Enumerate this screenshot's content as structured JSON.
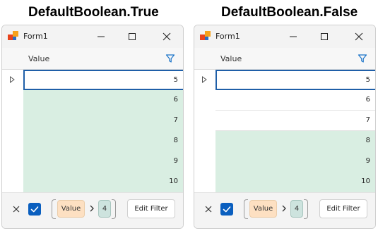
{
  "panels": [
    {
      "caption": "DefaultBoolean.True",
      "window_title": "Form1",
      "column_header": "Value",
      "rows": [
        {
          "value": "5",
          "highlighted": false,
          "focused": true
        },
        {
          "value": "6",
          "highlighted": true,
          "focused": false
        },
        {
          "value": "7",
          "highlighted": true,
          "focused": false
        },
        {
          "value": "8",
          "highlighted": true,
          "focused": false
        },
        {
          "value": "9",
          "highlighted": true,
          "focused": false
        },
        {
          "value": "10",
          "highlighted": true,
          "focused": false
        }
      ],
      "filter": {
        "field": "Value",
        "operator": ">",
        "value": "4",
        "edit_label": "Edit Filter",
        "enabled": true
      }
    },
    {
      "caption": "DefaultBoolean.False",
      "window_title": "Form1",
      "column_header": "Value",
      "rows": [
        {
          "value": "5",
          "highlighted": false,
          "focused": true
        },
        {
          "value": "6",
          "highlighted": false,
          "focused": false
        },
        {
          "value": "7",
          "highlighted": false,
          "focused": false
        },
        {
          "value": "8",
          "highlighted": true,
          "focused": false
        },
        {
          "value": "9",
          "highlighted": true,
          "focused": false
        },
        {
          "value": "10",
          "highlighted": true,
          "focused": false
        }
      ],
      "filter": {
        "field": "Value",
        "operator": ">",
        "value": "4",
        "edit_label": "Edit Filter",
        "enabled": true
      }
    }
  ],
  "colors": {
    "highlight_row": "#d9eee2",
    "focus_border": "#1f5fa8",
    "accent_blue": "#0a5fbf",
    "filter_field_chip": "#fde0c2",
    "filter_value_chip": "#cde3de",
    "filter_icon": "#1a73c8"
  },
  "icons": {
    "app": "winforms-app-icon",
    "minimize": "minimize-icon",
    "maximize": "maximize-icon",
    "close": "close-icon",
    "column_filter": "filter-funnel-icon",
    "row_indicator": "triangle-right-icon",
    "clear_filter": "close-icon",
    "filter_enabled": "checkbox-checked-icon",
    "operator": "chevron-right-icon"
  }
}
